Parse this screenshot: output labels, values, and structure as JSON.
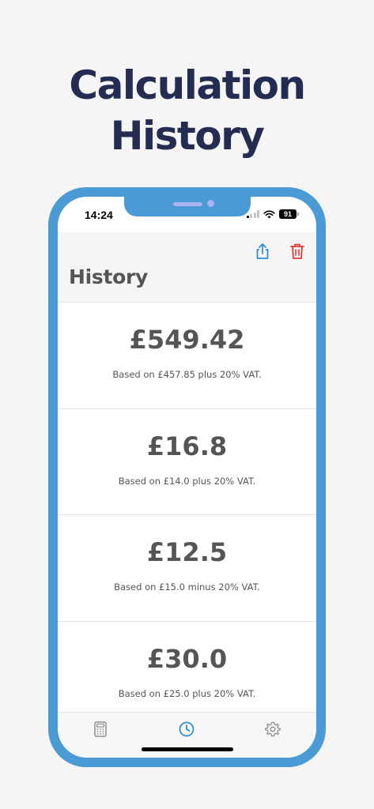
{
  "promo": {
    "title_line1": "Calculation",
    "title_line2": "History"
  },
  "status_bar": {
    "time": "14:24",
    "battery": "91"
  },
  "nav": {
    "title": "History",
    "share_icon": "share-icon",
    "trash_icon": "trash-icon"
  },
  "history": {
    "items": [
      {
        "amount": "£549.42",
        "description": "Based on £457.85 plus 20% VAT."
      },
      {
        "amount": "£16.8",
        "description": "Based on £14.0 plus 20% VAT."
      },
      {
        "amount": "£12.5",
        "description": "Based on £15.0 minus 20% VAT."
      },
      {
        "amount": "£30.0",
        "description": "Based on £25.0 plus 20% VAT."
      }
    ]
  },
  "tab_bar": {
    "tabs": [
      {
        "icon": "calculator-icon",
        "active": false
      },
      {
        "icon": "clock-icon",
        "active": true
      },
      {
        "icon": "gear-icon",
        "active": false
      }
    ]
  },
  "colors": {
    "frame": "#4a9ad5",
    "promo_title": "#252c52",
    "share": "#2f8fd6",
    "trash": "#e53935",
    "active_tab": "#2f8fd6",
    "inactive_tab": "#8e8e93",
    "text": "#555555"
  }
}
